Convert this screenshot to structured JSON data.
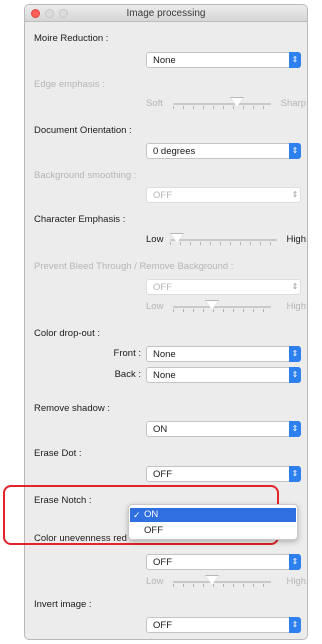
{
  "window": {
    "title": "Image processing"
  },
  "moire": {
    "label": "Moire Reduction :",
    "value": "None"
  },
  "edge": {
    "label": "Edge emphasis :",
    "left": "Soft",
    "right": "Sharp"
  },
  "orientation": {
    "label": "Document Orientation :",
    "value": "0 degrees"
  },
  "bgsmooth": {
    "label": "Background smoothing :",
    "value": "OFF"
  },
  "charemph": {
    "label": "Character Emphasis :",
    "left": "Low",
    "right": "High"
  },
  "bleed": {
    "label": "Prevent Bleed Through / Remove Background :",
    "value": "OFF",
    "left": "Low",
    "right": "High"
  },
  "dropout": {
    "label": "Color drop-out :",
    "front_label": "Front :",
    "front_value": "None",
    "back_label": "Back :",
    "back_value": "None"
  },
  "shadow": {
    "label": "Remove shadow :",
    "value": "ON"
  },
  "erasedot": {
    "label": "Erase Dot :",
    "value": "OFF"
  },
  "erasenotch": {
    "label": "Erase Notch :",
    "options": [
      "ON",
      "OFF"
    ],
    "selected": "ON"
  },
  "uneven": {
    "label": "Color unevenness red",
    "value": "OFF",
    "left": "Low",
    "right": "High"
  },
  "invert": {
    "label": "Invert image :",
    "value": "OFF"
  },
  "colors": {
    "accent": "#2f80ef",
    "highlight": "#e3222a"
  }
}
